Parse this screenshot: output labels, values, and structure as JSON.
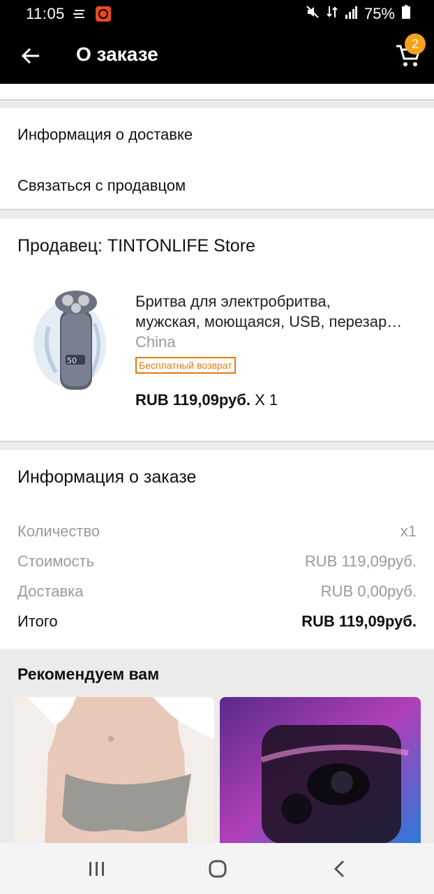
{
  "status_bar": {
    "time": "11:05",
    "battery": "75%"
  },
  "app_bar": {
    "title": "О заказе",
    "cart_count": "2"
  },
  "links": {
    "delivery_info": "Информация о доставке",
    "contact_seller": "Связаться с продавцом"
  },
  "seller": {
    "label": "Продавец: TINTONLIFE Store"
  },
  "product": {
    "title_line1": "Бритва для электробритва,",
    "title_line2": "мужская, моющаяся, USB, перезар…",
    "origin": "China",
    "badge": "Бесплатный возврат",
    "price": "RUB 119,09руб.",
    "qty": "X 1"
  },
  "order_info": {
    "title": "Информация о заказе",
    "rows": [
      {
        "label": "Количество",
        "value": "x1"
      },
      {
        "label": "Стоимость",
        "value": "RUB 119,09руб."
      },
      {
        "label": "Доставка",
        "value": "RUB 0,00руб."
      }
    ],
    "total": {
      "label": "Итого",
      "value": "RUB 119,09руб."
    }
  },
  "recommend": {
    "title": "Рекомендуем вам"
  },
  "colors": {
    "accent_orange": "#f7a21b",
    "badge_orange": "#e8780f",
    "bar_black": "#000000"
  }
}
